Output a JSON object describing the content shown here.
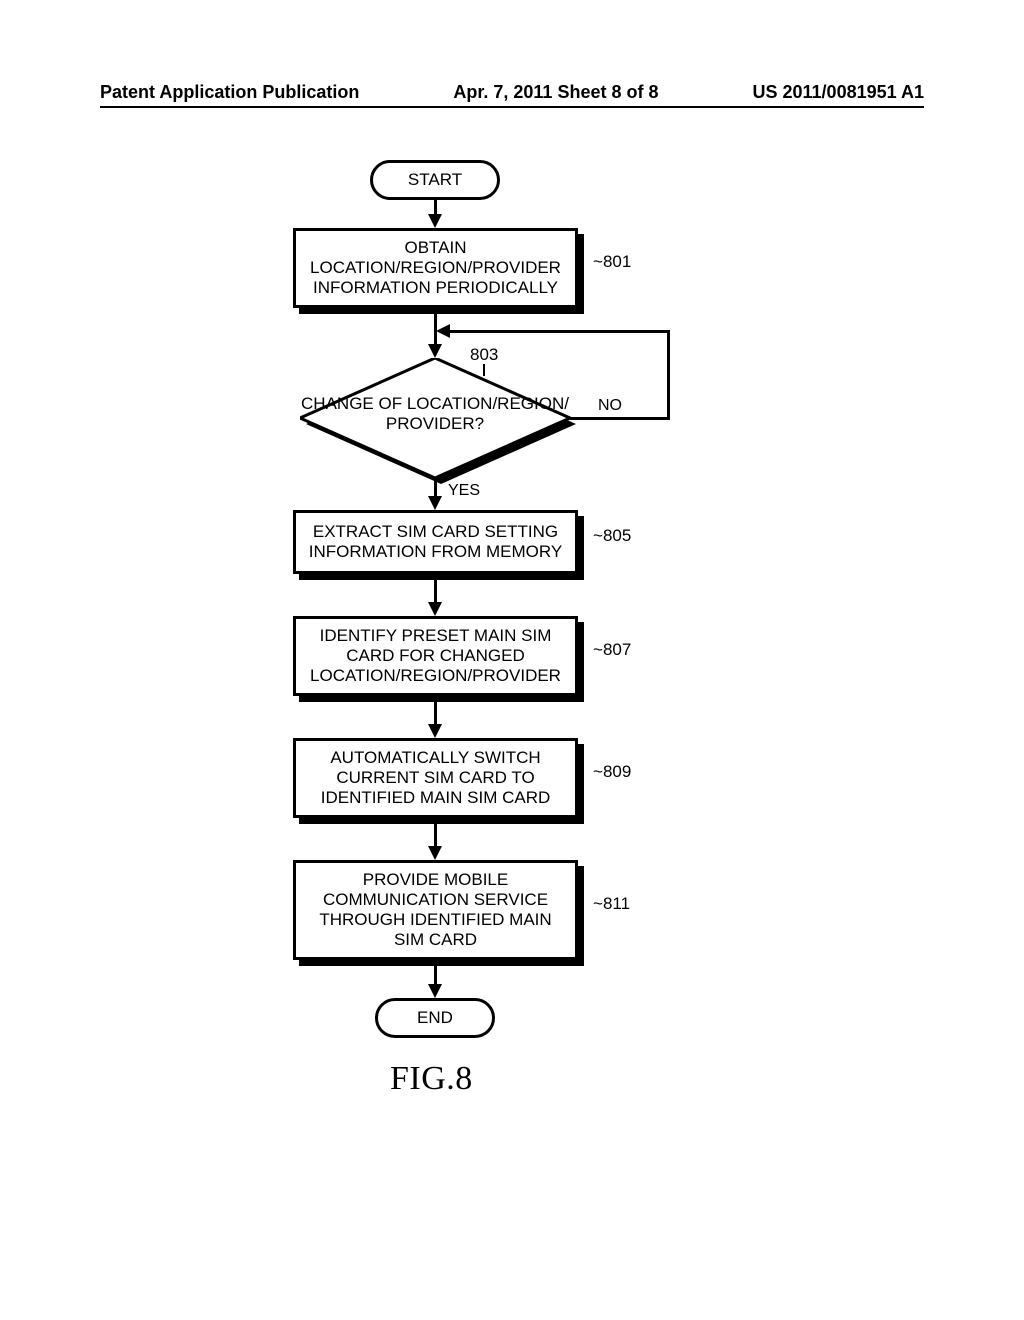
{
  "header": {
    "left": "Patent Application Publication",
    "center": "Apr. 7, 2011  Sheet 8 of 8",
    "right": "US 2011/0081951 A1"
  },
  "figure_label": "FIG.8",
  "terminators": {
    "start": "START",
    "end": "END"
  },
  "steps": {
    "s801": "OBTAIN LOCATION/REGION/PROVIDER INFORMATION PERIODICALLY",
    "s805": "EXTRACT SIM CARD SETTING INFORMATION FROM MEMORY",
    "s807": "IDENTIFY PRESET MAIN SIM CARD FOR CHANGED LOCATION/REGION/PROVIDER",
    "s809": "AUTOMATICALLY SWITCH CURRENT SIM CARD TO IDENTIFIED MAIN SIM CARD",
    "s811": "PROVIDE MOBILE COMMUNICATION SERVICE THROUGH IDENTIFIED MAIN SIM CARD"
  },
  "decision": {
    "s803": "CHANGE OF LOCATION/REGION/ PROVIDER?"
  },
  "decision_labels": {
    "yes": "YES",
    "no": "NO"
  },
  "refs": {
    "r801": "801",
    "r803": "803",
    "r805": "805",
    "r807": "807",
    "r809": "809",
    "r811": "811"
  },
  "chart_data": {
    "type": "flowchart",
    "title": "FIG.8",
    "nodes": [
      {
        "id": "start",
        "kind": "terminator",
        "text": "START"
      },
      {
        "id": "801",
        "kind": "process",
        "text": "OBTAIN LOCATION/REGION/PROVIDER INFORMATION PERIODICALLY"
      },
      {
        "id": "803",
        "kind": "decision",
        "text": "CHANGE OF LOCATION/REGION/PROVIDER?"
      },
      {
        "id": "805",
        "kind": "process",
        "text": "EXTRACT SIM CARD SETTING INFORMATION FROM MEMORY"
      },
      {
        "id": "807",
        "kind": "process",
        "text": "IDENTIFY PRESET MAIN SIM CARD FOR CHANGED LOCATION/REGION/PROVIDER"
      },
      {
        "id": "809",
        "kind": "process",
        "text": "AUTOMATICALLY SWITCH CURRENT SIM CARD TO IDENTIFIED MAIN SIM CARD"
      },
      {
        "id": "811",
        "kind": "process",
        "text": "PROVIDE MOBILE COMMUNICATION SERVICE THROUGH IDENTIFIED MAIN SIM CARD"
      },
      {
        "id": "end",
        "kind": "terminator",
        "text": "END"
      }
    ],
    "edges": [
      {
        "from": "start",
        "to": "801"
      },
      {
        "from": "801",
        "to": "803"
      },
      {
        "from": "803",
        "to": "805",
        "label": "YES"
      },
      {
        "from": "803",
        "to": "803",
        "label": "NO",
        "note": "loop back to decision input"
      },
      {
        "from": "805",
        "to": "807"
      },
      {
        "from": "807",
        "to": "809"
      },
      {
        "from": "809",
        "to": "811"
      },
      {
        "from": "811",
        "to": "end"
      }
    ]
  }
}
